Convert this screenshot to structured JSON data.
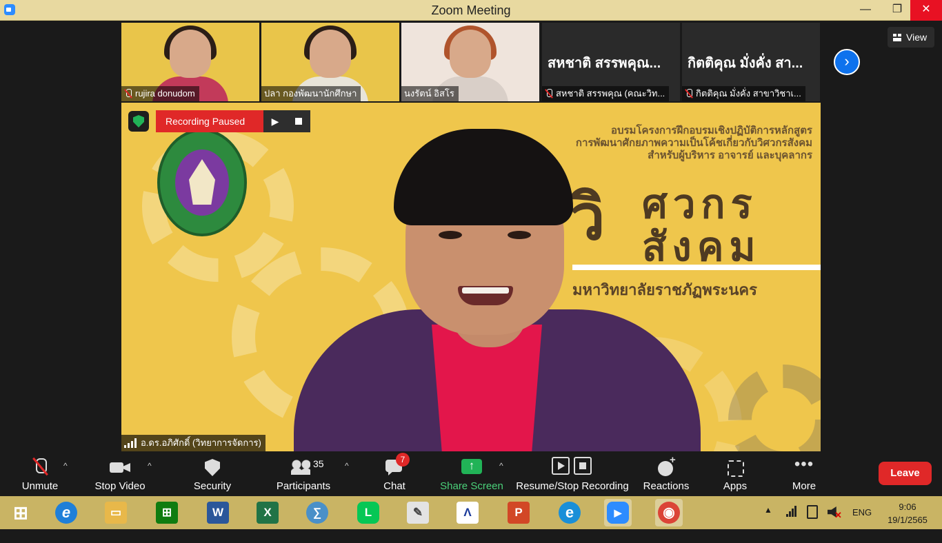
{
  "window": {
    "title": "Zoom Meeting",
    "min_glyph": "—",
    "max_glyph": "❐",
    "close_glyph": "✕"
  },
  "thumbnails": [
    {
      "name": "rujira donudom",
      "muted": true,
      "kind": "video"
    },
    {
      "name": "ปลา กองพัฒนานักศึกษา",
      "muted": false,
      "kind": "video"
    },
    {
      "name": "นงรัตน์ อิสโร",
      "muted": false,
      "kind": "video"
    },
    {
      "display": "สหชาติ สรรพคุณ...",
      "name": "สหชาติ สรรพคุณ (คณะวิท...",
      "muted": true,
      "kind": "name"
    },
    {
      "display": "กิตติคุณ  มั่งคั่ง สา...",
      "name": "กิตติคุณ  มั่งคั่ง สาขาวิชาเ...",
      "muted": true,
      "kind": "name"
    }
  ],
  "view_button": {
    "label": "View"
  },
  "next_page_glyph": "›",
  "recording": {
    "status": "Recording Paused",
    "play_glyph": "▶"
  },
  "banner": {
    "line1": "อบรมโครงการฝึกอบรมเชิงปฏิบัติการหลักสูตร",
    "line2": "การพัฒนาศักยภาพความเป็นโค้ชเกี่ยวกับวิศวกรสังคม",
    "line3": "สำหรับผู้บริหาร อาจารย์ และบุคลากร",
    "big_prefix": "วิ",
    "big_word1": "ศวกร",
    "big_word2": "สังคม",
    "university": "มหาวิทยาลัยราชภัฏพระนคร"
  },
  "active_speaker": {
    "name": "อ.ดร.อภิศักดิ์ (วิทยาการจัดการ)"
  },
  "toolbar": {
    "unmute": "Unmute",
    "stop_video": "Stop Video",
    "security": "Security",
    "participants": "Participants",
    "participant_count": "35",
    "chat": "Chat",
    "chat_badge": "7",
    "share_screen": "Share Screen",
    "resume_stop_recording": "Resume/Stop Recording",
    "reactions": "Reactions",
    "apps": "Apps",
    "more": "More",
    "more_glyph": "•••",
    "caret": "^",
    "leave": "Leave"
  },
  "taskbar": {
    "apps": [
      {
        "name": "start",
        "color": "#ffffff",
        "glyph": "⊞"
      },
      {
        "name": "internet-explorer",
        "color": "#1f7fd8",
        "glyph": "e"
      },
      {
        "name": "file-explorer",
        "color": "#e8b84a",
        "glyph": "▭"
      },
      {
        "name": "store",
        "color": "#107c10",
        "glyph": "⊞"
      },
      {
        "name": "word",
        "color": "#2b579a",
        "glyph": "W"
      },
      {
        "name": "excel",
        "color": "#217346",
        "glyph": "X"
      },
      {
        "name": "math-input",
        "color": "#4a90c8",
        "glyph": "∑"
      },
      {
        "name": "line",
        "color": "#06c755",
        "glyph": "L"
      },
      {
        "name": "paint",
        "color": "#e3e3e3",
        "glyph": "✎"
      },
      {
        "name": "lisrel",
        "color": "#ffffff",
        "glyph": "Λ"
      },
      {
        "name": "powerpoint",
        "color": "#d24726",
        "glyph": "P"
      },
      {
        "name": "edge",
        "color": "#1a8fd8",
        "glyph": "e"
      },
      {
        "name": "zoom",
        "color": "#2d8cff",
        "glyph": "▶"
      },
      {
        "name": "chrome",
        "color": "#db4437",
        "glyph": "◉"
      }
    ],
    "tray": {
      "arrow_glyph": "▲",
      "mute_glyph": "✕",
      "language": "ENG",
      "time": "9:06",
      "date": "19/1/2565"
    }
  }
}
